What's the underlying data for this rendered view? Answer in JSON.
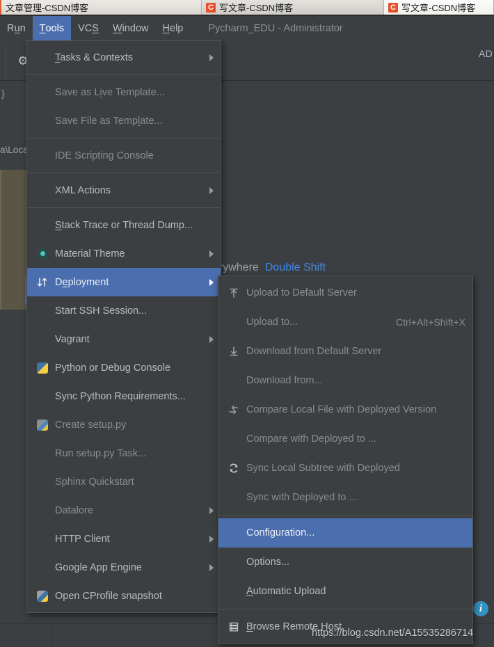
{
  "browser_tabs": [
    {
      "title": "文章管理-CSDN博客",
      "favicon": "",
      "active": false
    },
    {
      "title": "写文章-CSDN博客",
      "favicon": "C",
      "active": false
    },
    {
      "title": "写文章-CSDN博客",
      "favicon": "C",
      "active": true
    }
  ],
  "menubar": {
    "items": [
      {
        "label": "Run",
        "mnemonic": "u",
        "active": false
      },
      {
        "label": "Tools",
        "mnemonic": "T",
        "active": true
      },
      {
        "label": "VCS",
        "mnemonic": "S",
        "active": false
      },
      {
        "label": "Window",
        "mnemonic": "W",
        "active": false
      },
      {
        "label": "Help",
        "mnemonic": "H",
        "active": false
      }
    ],
    "window_title": "Pycharm_EDU - Administrator"
  },
  "background": {
    "gear_icon": "gear-icon",
    "ad_text": "AD",
    "path_fragment": "a\\Loca",
    "brace_fragment": "}",
    "search_hint_text": "Search Everywhere",
    "search_hint_visible": "erywhere",
    "search_hint_shortcut": "Double Shift",
    "info_badge": "i"
  },
  "tools_menu": {
    "name": "Tools",
    "items": [
      {
        "label": "Tasks & Contexts",
        "mnemonic": "T",
        "icon": "",
        "submenu": true,
        "enabled": true
      },
      {
        "separator": true
      },
      {
        "label": "Save as Live Template...",
        "mnemonic": "i",
        "icon": "",
        "submenu": false,
        "enabled": false
      },
      {
        "label": "Save File as Template...",
        "mnemonic": "l",
        "icon": "",
        "submenu": false,
        "enabled": false
      },
      {
        "separator": true
      },
      {
        "label": "IDE Scripting Console",
        "icon": "",
        "submenu": false,
        "enabled": false
      },
      {
        "separator": true
      },
      {
        "label": "XML Actions",
        "icon": "",
        "submenu": true,
        "enabled": true
      },
      {
        "separator": true
      },
      {
        "label": "Stack Trace or Thread Dump...",
        "mnemonic": "S",
        "icon": "",
        "submenu": false,
        "enabled": true
      },
      {
        "label": "Material Theme",
        "icon": "material-theme-icon",
        "submenu": true,
        "enabled": true
      },
      {
        "label": "Deployment",
        "mnemonic": "e",
        "icon": "deployment-icon",
        "submenu": true,
        "enabled": true,
        "selected": true
      },
      {
        "label": "Start SSH Session...",
        "icon": "",
        "submenu": false,
        "enabled": true
      },
      {
        "label": "Vagrant",
        "icon": "",
        "submenu": true,
        "enabled": true
      },
      {
        "label": "Python or Debug Console",
        "icon": "python-console-icon",
        "submenu": false,
        "enabled": true
      },
      {
        "label": "Sync Python Requirements...",
        "icon": "",
        "submenu": false,
        "enabled": true
      },
      {
        "label": "Create setup.py",
        "icon": "python-setup-icon",
        "submenu": false,
        "enabled": false
      },
      {
        "label": "Run setup.py Task...",
        "icon": "",
        "submenu": false,
        "enabled": false
      },
      {
        "label": "Sphinx Quickstart",
        "icon": "",
        "submenu": false,
        "enabled": false
      },
      {
        "label": "Datalore",
        "icon": "",
        "submenu": true,
        "enabled": false
      },
      {
        "label": "HTTP Client",
        "icon": "",
        "submenu": true,
        "enabled": true
      },
      {
        "label": "Google App Engine",
        "icon": "",
        "submenu": true,
        "enabled": true
      },
      {
        "label": "Open CProfile snapshot",
        "icon": "cprofile-icon",
        "submenu": false,
        "enabled": true
      }
    ]
  },
  "deployment_menu": {
    "name": "Deployment",
    "items": [
      {
        "label": "Upload to Default Server",
        "icon": "upload-icon",
        "accel": "",
        "enabled": false
      },
      {
        "label": "Upload to...",
        "icon": "",
        "accel": "Ctrl+Alt+Shift+X",
        "enabled": false
      },
      {
        "label": "Download from Default Server",
        "icon": "download-icon",
        "accel": "",
        "enabled": false
      },
      {
        "label": "Download from...",
        "icon": "",
        "accel": "",
        "enabled": false
      },
      {
        "label": "Compare Local File with Deployed Version",
        "icon": "compare-icon",
        "accel": "",
        "enabled": false
      },
      {
        "label": "Compare with Deployed to ...",
        "icon": "",
        "accel": "",
        "enabled": false
      },
      {
        "label": "Sync Local Subtree with Deployed",
        "icon": "sync-icon",
        "accel": "",
        "enabled": false
      },
      {
        "label": "Sync with Deployed to ...",
        "icon": "",
        "accel": "",
        "enabled": false
      },
      {
        "separator": true
      },
      {
        "label": "Configuration...",
        "icon": "",
        "accel": "",
        "enabled": true,
        "selected": true
      },
      {
        "label": "Options...",
        "icon": "",
        "accel": "",
        "enabled": true
      },
      {
        "label": "Automatic Upload",
        "mnemonic": "A",
        "icon": "",
        "accel": "",
        "enabled": true
      },
      {
        "separator": true
      },
      {
        "label": "Browse Remote Host",
        "mnemonic": "B",
        "icon": "remote-host-icon",
        "accel": "",
        "enabled": true
      }
    ]
  },
  "watermark": {
    "text": "https://blog.csdn.net/A15535286714"
  },
  "colors": {
    "menu_bg": "#3c3f41",
    "menu_border": "#4f5355",
    "selection": "#4b6eaf",
    "text": "#bbbbbb",
    "text_disabled": "#8a8d8f",
    "link_blue": "#3f87e8",
    "olive_panel": "#5b5546",
    "favicon_red": "#e8502a",
    "info_blue": "#3592c4"
  }
}
